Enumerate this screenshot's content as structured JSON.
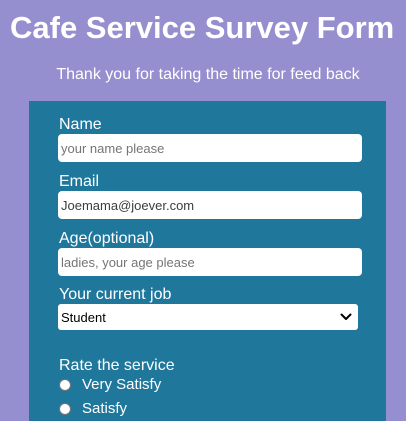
{
  "page": {
    "title": "Cafe Service Survey Form",
    "subtitle": "Thank you for taking the time for feed back"
  },
  "form": {
    "name": {
      "label": "Name",
      "placeholder": "your name please",
      "value": ""
    },
    "email": {
      "label": "Email",
      "placeholder": "",
      "value": "Joemama@joever.com"
    },
    "age": {
      "label": "Age(optional)",
      "placeholder": "ladies, your age please",
      "value": ""
    },
    "job": {
      "label": "Your current job",
      "selected": "Student"
    },
    "rating": {
      "label": "Rate the service",
      "options": [
        "Very Satisfy",
        "Satisfy"
      ]
    }
  },
  "colors": {
    "background": "#958fd0",
    "panel": "#1f789c",
    "text": "#ffffff"
  }
}
